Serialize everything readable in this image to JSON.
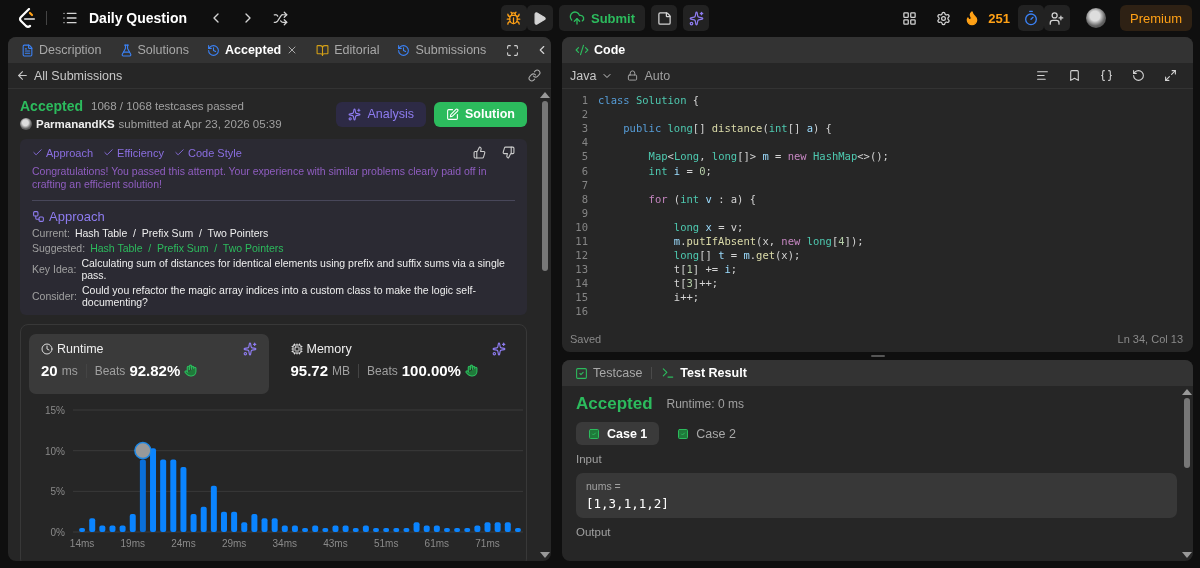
{
  "topbar": {
    "title": "Daily Question",
    "submit": "Submit",
    "streak": "251",
    "premium": "Premium"
  },
  "left_panel": {
    "tabs": [
      {
        "label": "Description",
        "selected": false,
        "closable": false
      },
      {
        "label": "Solutions",
        "selected": false,
        "closable": false
      },
      {
        "label": "Accepted",
        "selected": true,
        "closable": true
      },
      {
        "label": "Editorial",
        "selected": false,
        "closable": false
      },
      {
        "label": "Submissions",
        "selected": false,
        "closable": false
      }
    ],
    "back_link": "All Submissions",
    "result": {
      "status": "Accepted",
      "testcases": "1068 / 1068 testcases passed",
      "author": "ParmanandKS",
      "submitted": "submitted at Apr 23, 2026 05:39"
    },
    "buttons": [
      {
        "label": "Analysis",
        "kind": "analysis"
      },
      {
        "label": "Solution",
        "kind": "solution"
      }
    ],
    "analysis": {
      "checks": [
        "Approach",
        "Efficiency",
        "Code Style"
      ],
      "message": "Congratulations! You passed this attempt. Your experience with similar problems clearly paid off in crafting an efficient solution!",
      "heading": "Approach",
      "rows": [
        {
          "label": "Current:",
          "value": "Hash Table  /  Prefix Sum  /  Two Pointers",
          "kind": "plain"
        },
        {
          "label": "Suggested:",
          "value": "Hash Table  /  Prefix Sum  /  Two Pointers",
          "kind": "highlight"
        },
        {
          "label": "Key Idea:",
          "value": "Calculating sum of distances for identical elements using prefix and suffix sums via a single pass.",
          "kind": "plain"
        },
        {
          "label": "Consider:",
          "value": "Could you refactor the magic array indices into a custom class to make the logic self-documenting?",
          "kind": "plain"
        }
      ]
    },
    "stats": [
      {
        "label": "Runtime",
        "value": "20",
        "unit": "ms",
        "beats_label": "Beats",
        "beats": "92.82%",
        "selected": true
      },
      {
        "label": "Memory",
        "value": "95.72",
        "unit": "MB",
        "beats_label": "Beats",
        "beats": "100.00%",
        "selected": false
      }
    ],
    "chart_data": {
      "type": "bar",
      "categories": [
        "14ms",
        null,
        null,
        null,
        null,
        "19ms",
        null,
        null,
        null,
        null,
        "24ms",
        null,
        null,
        null,
        null,
        "29ms",
        null,
        null,
        null,
        null,
        "34ms",
        null,
        null,
        null,
        null,
        "43ms",
        null,
        null,
        null,
        null,
        "51ms",
        null,
        null,
        null,
        null,
        "61ms",
        null,
        null,
        null,
        null,
        "71ms",
        null,
        null,
        null
      ],
      "values": [
        0.5,
        1.7,
        0.8,
        0.8,
        0.8,
        2.2,
        8.9,
        10.3,
        8.9,
        8.9,
        8.0,
        2.2,
        3.1,
        5.7,
        2.5,
        2.5,
        1.2,
        2.2,
        1.7,
        1.7,
        0.8,
        0.8,
        0.5,
        0.8,
        0.5,
        0.8,
        0.8,
        0.5,
        0.8,
        0.5,
        0.5,
        0.5,
        0.5,
        1.2,
        0.8,
        0.8,
        0.5,
        0.5,
        0.5,
        0.8,
        1.2,
        1.2,
        1.2,
        0.5
      ],
      "ylim": [
        0,
        15
      ],
      "yticks": [
        {
          "value": 0,
          "label": "0%"
        },
        {
          "value": 5,
          "label": "5%"
        },
        {
          "value": 10,
          "label": "10%"
        },
        {
          "value": 15,
          "label": "15%"
        }
      ]
    }
  },
  "code_panel": {
    "title": "Code",
    "language": "Java",
    "mode": "Auto",
    "status": "Saved",
    "cursor": "Ln 34, Col 13",
    "lines": [
      {
        "number": "1",
        "tokens": [
          {
            "text": "class",
            "kind": "keyword"
          },
          {
            "text": " Solution",
            "kind": "type"
          },
          {
            "text": " {",
            "kind": "plain"
          }
        ]
      },
      {
        "number": "2"
      },
      {
        "number": "3",
        "tokens": [
          {
            "text": "    public",
            "kind": "keyword"
          },
          {
            "text": " long",
            "kind": "type"
          },
          {
            "text": "[] ",
            "kind": "plain"
          },
          {
            "text": "distance",
            "kind": "func"
          },
          {
            "text": "(",
            "kind": "plain"
          },
          {
            "text": "int",
            "kind": "type"
          },
          {
            "text": "[] ",
            "kind": "plain"
          },
          {
            "text": "a",
            "kind": "var"
          },
          {
            "text": ") {",
            "kind": "plain"
          }
        ]
      },
      {
        "number": "4"
      },
      {
        "number": "5",
        "tokens": [
          {
            "text": "        Map",
            "kind": "type"
          },
          {
            "text": "<",
            "kind": "plain"
          },
          {
            "text": "Long",
            "kind": "type"
          },
          {
            "text": ", ",
            "kind": "plain"
          },
          {
            "text": "long",
            "kind": "type"
          },
          {
            "text": "[]> ",
            "kind": "plain"
          },
          {
            "text": "m",
            "kind": "var"
          },
          {
            "text": " = ",
            "kind": "plain"
          },
          {
            "text": "new",
            "kind": "control"
          },
          {
            "text": " HashMap",
            "kind": "type"
          },
          {
            "text": "<>();",
            "kind": "plain"
          }
        ]
      },
      {
        "number": "6",
        "tokens": [
          {
            "text": "        int",
            "kind": "type"
          },
          {
            "text": " i",
            "kind": "var"
          },
          {
            "text": " = ",
            "kind": "plain"
          },
          {
            "text": "0",
            "kind": "num"
          },
          {
            "text": ";",
            "kind": "plain"
          }
        ]
      },
      {
        "number": "7"
      },
      {
        "number": "8",
        "tokens": [
          {
            "text": "        for",
            "kind": "control"
          },
          {
            "text": " (",
            "kind": "plain"
          },
          {
            "text": "int",
            "kind": "type"
          },
          {
            "text": " v",
            "kind": "var"
          },
          {
            "text": " : a) {",
            "kind": "plain"
          }
        ]
      },
      {
        "number": "9"
      },
      {
        "number": "10",
        "tokens": [
          {
            "text": "            long",
            "kind": "type"
          },
          {
            "text": " x",
            "kind": "var"
          },
          {
            "text": " = v;",
            "kind": "plain"
          }
        ]
      },
      {
        "number": "11",
        "tokens": [
          {
            "text": "            m",
            "kind": "var"
          },
          {
            "text": ".",
            "kind": "plain"
          },
          {
            "text": "putIfAbsent",
            "kind": "func"
          },
          {
            "text": "(x, ",
            "kind": "plain"
          },
          {
            "text": "new",
            "kind": "control"
          },
          {
            "text": " long",
            "kind": "type"
          },
          {
            "text": "[",
            "kind": "plain"
          },
          {
            "text": "4",
            "kind": "num"
          },
          {
            "text": "]);",
            "kind": "plain"
          }
        ]
      },
      {
        "number": "12",
        "tokens": [
          {
            "text": "            long",
            "kind": "type"
          },
          {
            "text": "[] ",
            "kind": "plain"
          },
          {
            "text": "t",
            "kind": "var"
          },
          {
            "text": " = ",
            "kind": "plain"
          },
          {
            "text": "m",
            "kind": "var"
          },
          {
            "text": ".",
            "kind": "plain"
          },
          {
            "text": "get",
            "kind": "func"
          },
          {
            "text": "(x);",
            "kind": "plain"
          }
        ]
      },
      {
        "number": "13",
        "tokens": [
          {
            "text": "            t[",
            "kind": "plain"
          },
          {
            "text": "1",
            "kind": "num"
          },
          {
            "text": "] += ",
            "kind": "plain"
          },
          {
            "text": "i",
            "kind": "var"
          },
          {
            "text": ";",
            "kind": "plain"
          }
        ]
      },
      {
        "number": "14",
        "tokens": [
          {
            "text": "            t[",
            "kind": "plain"
          },
          {
            "text": "3",
            "kind": "num"
          },
          {
            "text": "]++;",
            "kind": "plain"
          }
        ]
      },
      {
        "number": "15",
        "tokens": [
          {
            "text": "            i++;",
            "kind": "plain"
          }
        ]
      },
      {
        "number": "16"
      }
    ]
  },
  "test_panel": {
    "tabs": [
      {
        "label": "Testcase",
        "selected": false
      },
      {
        "label": "Test Result",
        "selected": true
      }
    ],
    "status": "Accepted",
    "runtime": "Runtime: 0 ms",
    "cases": [
      {
        "label": "Case 1",
        "selected": true
      },
      {
        "label": "Case 2",
        "selected": false
      }
    ],
    "input_label": "Input",
    "variable": "nums =",
    "value": "[1,3,1,1,2]",
    "output_label": "Output"
  }
}
